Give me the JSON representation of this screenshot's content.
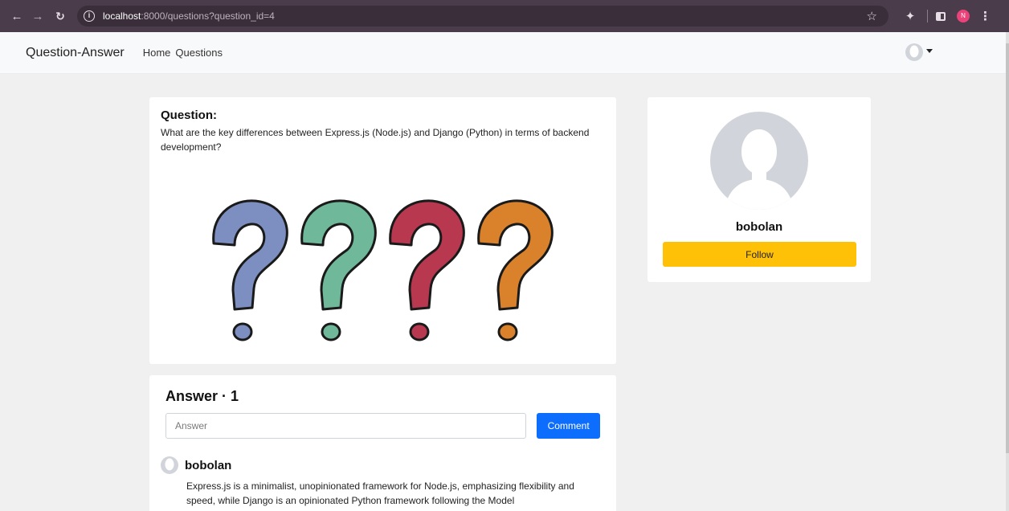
{
  "browser": {
    "url_host": "localhost",
    "url_path": ":8000/questions?question_id=4",
    "profile_initial": "N"
  },
  "navbar": {
    "brand": "Question-Answer",
    "links": [
      "Home",
      "Questions"
    ]
  },
  "question": {
    "heading": "Question:",
    "text": "What are the key differences between Express.js (Node.js) and Django (Python) in terms of backend development?",
    "illustration_colors": [
      "#7d8ec0",
      "#6fb89a",
      "#b8384f",
      "#d9822b"
    ]
  },
  "answers": {
    "heading": "Answer · 1",
    "input_placeholder": "Answer",
    "comment_label": "Comment",
    "items": [
      {
        "author": "bobolan",
        "text": "Express.js is a minimalist, unopinionated framework for Node.js, emphasizing flexibility and speed, while Django is an opinionated Python framework following the Model"
      }
    ]
  },
  "profile": {
    "name": "bobolan",
    "follow_label": "Follow"
  },
  "colors": {
    "primary": "#0d6efd",
    "warning": "#ffc107",
    "avatar_gray": "#d1d5db"
  }
}
